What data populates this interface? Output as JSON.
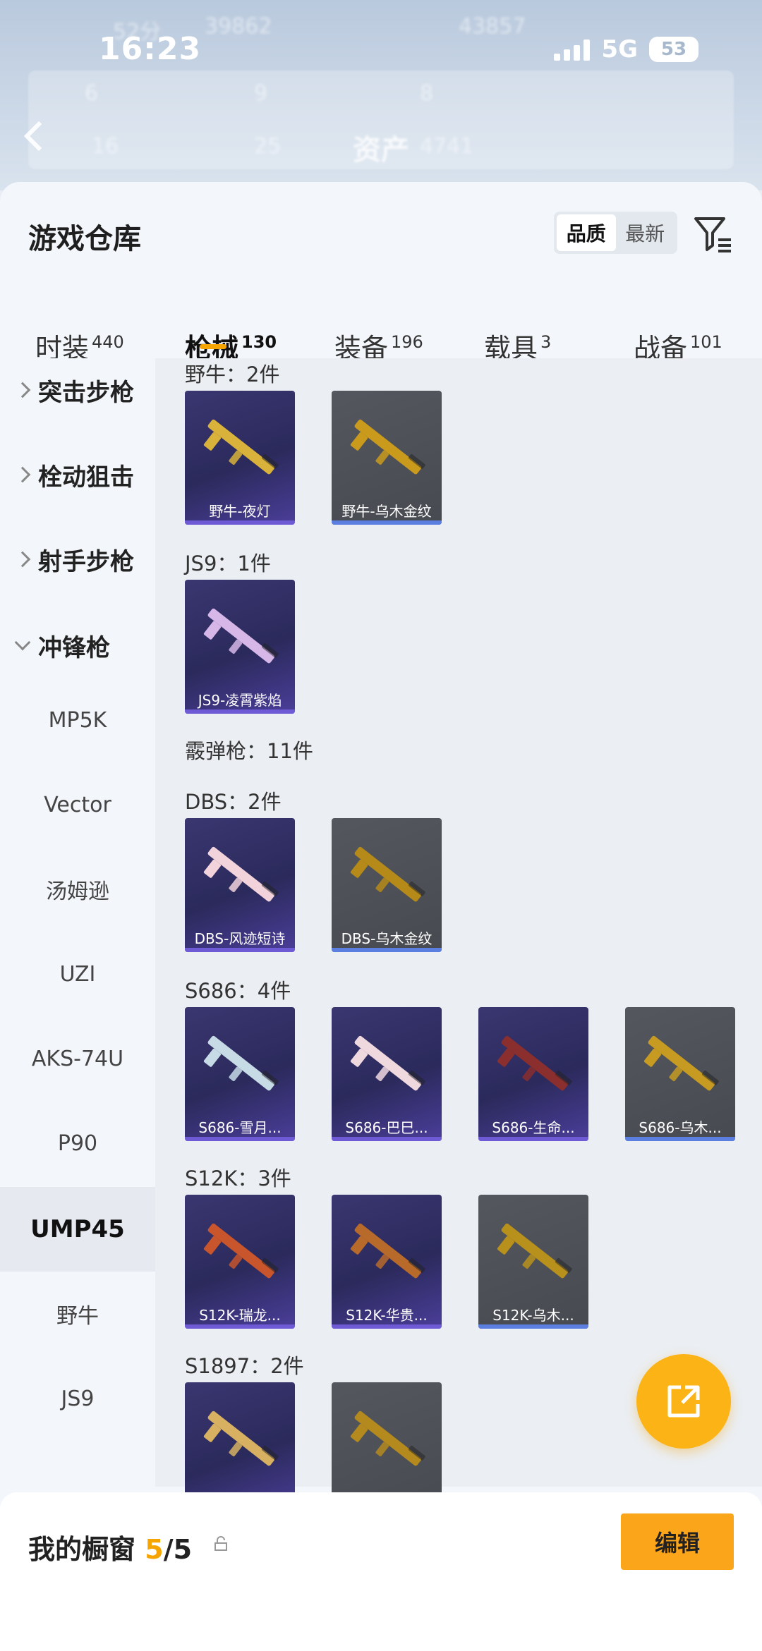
{
  "status_bar": {
    "time": "16:23",
    "network": "5G",
    "battery": "53"
  },
  "background_header": {
    "title": "资产",
    "ghost_values": [
      "52分",
      "39862",
      "43857",
      "6",
      "9",
      "8",
      "16",
      "25",
      "4741"
    ]
  },
  "sheet": {
    "title": "游戏仓库",
    "sort_options": [
      "品质",
      "最新"
    ],
    "tabs": [
      {
        "label": "时装",
        "count": "440"
      },
      {
        "label": "枪械",
        "count": "130"
      },
      {
        "label": "装备",
        "count": "196"
      },
      {
        "label": "载具",
        "count": "3"
      },
      {
        "label": "战备",
        "count": "101"
      }
    ]
  },
  "sidebar": {
    "categories": [
      "突击步枪",
      "栓动狙击",
      "射手步枪",
      "冲锋枪"
    ],
    "subitems": [
      "MP5K",
      "Vector",
      "汤姆逊",
      "UZI",
      "AKS-74U",
      "P90",
      "UMP45",
      "野牛",
      "JS9"
    ]
  },
  "groups": [
    {
      "label": "野牛：2件",
      "items": [
        {
          "name": "野牛-夜灯",
          "style": "purple",
          "gun": "#d8b23a"
        },
        {
          "name": "野牛-乌木金纹",
          "style": "gray",
          "gun": "#c99a1c"
        }
      ]
    },
    {
      "label": "JS9：1件",
      "items": [
        {
          "name": "JS9-凌霄紫焰",
          "style": "purple",
          "gun": "#d6b7e8"
        }
      ]
    },
    {
      "label": "霰弹枪：11件",
      "items": []
    },
    {
      "label": "DBS：2件",
      "items": [
        {
          "name": "DBS-风迹短诗",
          "style": "purple",
          "gun": "#f2d3dc"
        },
        {
          "name": "DBS-乌木金纹",
          "style": "gray",
          "gun": "#b58a18"
        }
      ]
    },
    {
      "label": "S686：4件",
      "items": [
        {
          "name": "S686-雪月...",
          "style": "purple",
          "gun": "#c7dbe6"
        },
        {
          "name": "S686-巴巳...",
          "style": "purple",
          "gun": "#f0d8df"
        },
        {
          "name": "S686-生命...",
          "style": "purple",
          "gun": "#8a2e2e"
        },
        {
          "name": "S686-乌木...",
          "style": "gray",
          "gun": "#c79b22"
        }
      ]
    },
    {
      "label": "S12K：3件",
      "items": [
        {
          "name": "S12K-瑞龙...",
          "style": "purple",
          "gun": "#c8552c"
        },
        {
          "name": "S12K-华贵...",
          "style": "purple",
          "gun": "#b86a2a"
        },
        {
          "name": "S12K-乌木...",
          "style": "gray",
          "gun": "#b8901c"
        }
      ]
    },
    {
      "label": "S1897：2件",
      "items": [
        {
          "name": "",
          "style": "purple",
          "gun": "#d7b062"
        },
        {
          "name": "",
          "style": "gray",
          "gun": "#b48a1e"
        }
      ]
    }
  ],
  "bottom_bar": {
    "label_prefix": "我的橱窗",
    "current": "5",
    "total": "/5",
    "edit_label": "编辑"
  },
  "icons": {
    "filter": "filter-icon",
    "fab": "share-external-icon",
    "back": "chevron-left-icon",
    "lock": "lock-icon"
  }
}
